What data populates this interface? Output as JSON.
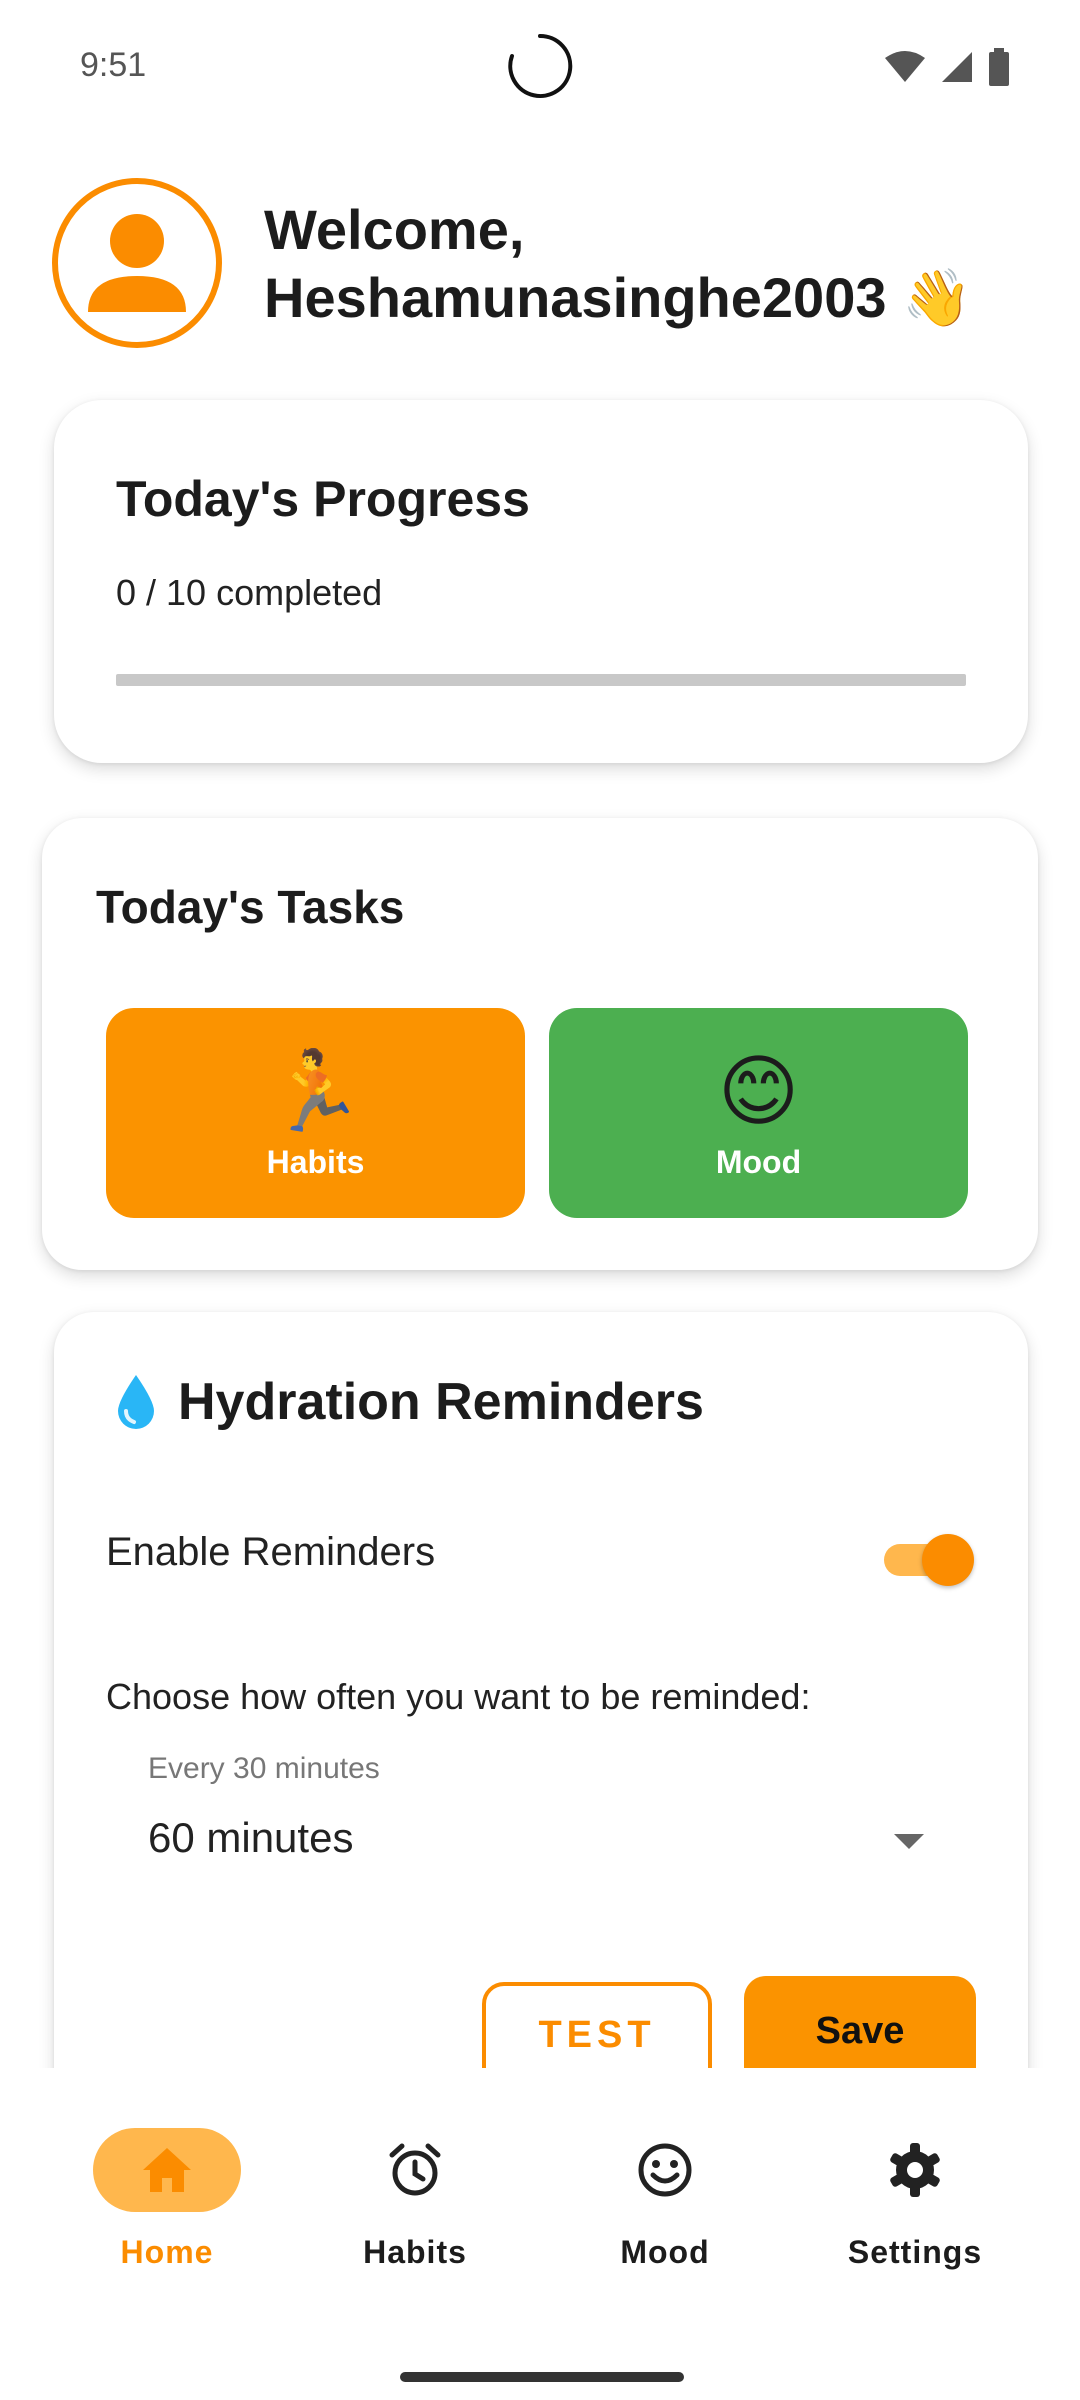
{
  "status_bar": {
    "time": "9:51"
  },
  "header": {
    "welcome_text": "Welcome, Heshamunasinghe2003 👋"
  },
  "progress": {
    "title": "Today's Progress",
    "count_text": "0 / 10 completed",
    "completed": 0,
    "total": 10,
    "fraction": 0
  },
  "tasks": {
    "title": "Today's Tasks",
    "items": [
      {
        "emoji": "🏃",
        "label": "Habits",
        "color": "#fb9300"
      },
      {
        "emoji": "😊",
        "label": "Mood",
        "color": "#4caf50"
      }
    ]
  },
  "hydration": {
    "title": "Hydration Reminders",
    "title_icon": "💧",
    "enable_label": "Enable Reminders",
    "enabled": true,
    "frequency_prompt": "Choose how often you want to be reminded:",
    "select_caption": "Every 30 minutes",
    "select_value": "60 minutes",
    "test_label": "TEST",
    "save_label": "Save"
  },
  "bottom_nav": {
    "items": [
      {
        "label": "Home",
        "icon": "home-icon",
        "active": true
      },
      {
        "label": "Habits",
        "icon": "alarm-clock-icon",
        "active": false
      },
      {
        "label": "Mood",
        "icon": "smiley-icon",
        "active": false
      },
      {
        "label": "Settings",
        "icon": "gear-icon",
        "active": false
      }
    ]
  },
  "colors": {
    "accent": "#fb8c00",
    "accent_light": "#ffb74d",
    "mood_green": "#4caf50"
  }
}
